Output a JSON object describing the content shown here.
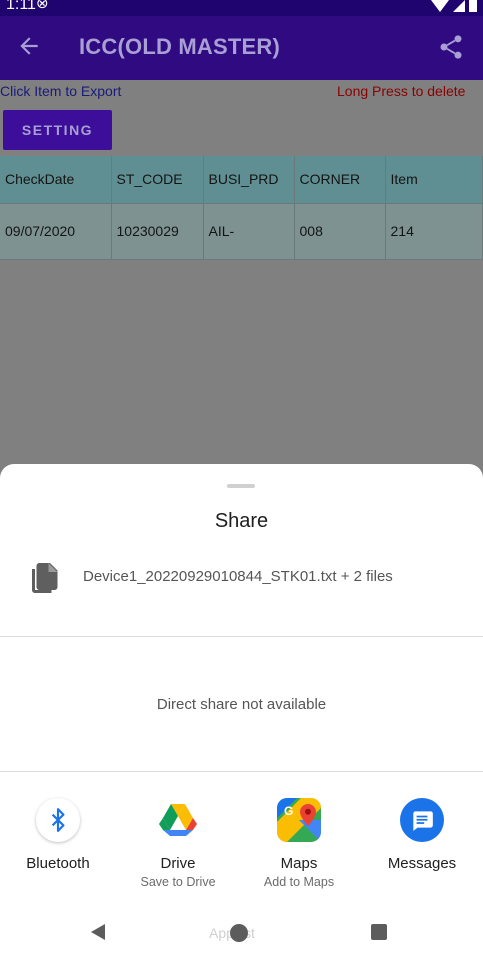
{
  "status_bar": {
    "time": "1:11",
    "left_icon": "do-not-disturb-icon",
    "right_icons": [
      "wifi-icon",
      "signal-icon",
      "battery-icon"
    ]
  },
  "app_bar": {
    "back_icon": "arrow-left-icon",
    "title": "ICC(OLD MASTER)",
    "share_icon": "share-icon",
    "background": "#300a80",
    "title_color": "#a89fd4"
  },
  "hints": {
    "export": "Click Item to Export",
    "delete": "Long Press to delete"
  },
  "setting_button": {
    "label": "SETTING"
  },
  "table": {
    "columns": [
      "CheckDate",
      "ST_CODE",
      "BUSI_PRD",
      "CORNER",
      "Item"
    ],
    "rows": [
      [
        "09/07/2020",
        "10230029",
        "AIL-",
        "008",
        "214"
      ]
    ]
  },
  "share_sheet": {
    "title": "Share",
    "file_icon": "file-copy-icon",
    "file_name": "Device1_20220929010844_STK01.txt + 2 files",
    "direct_share": "Direct share not available",
    "targets": [
      {
        "label": "Bluetooth",
        "sub": "",
        "icon": "bluetooth-icon"
      },
      {
        "label": "Drive",
        "sub": "Save to Drive",
        "icon": "google-drive-icon"
      },
      {
        "label": "Maps",
        "sub": "Add to Maps",
        "icon": "google-maps-icon"
      },
      {
        "label": "Messages",
        "sub": "",
        "icon": "messages-icon"
      }
    ],
    "nav_ghost_text": "App list"
  },
  "nav_bar": {
    "icons": [
      "nav-back-icon",
      "nav-home-icon",
      "nav-recents-icon"
    ]
  }
}
